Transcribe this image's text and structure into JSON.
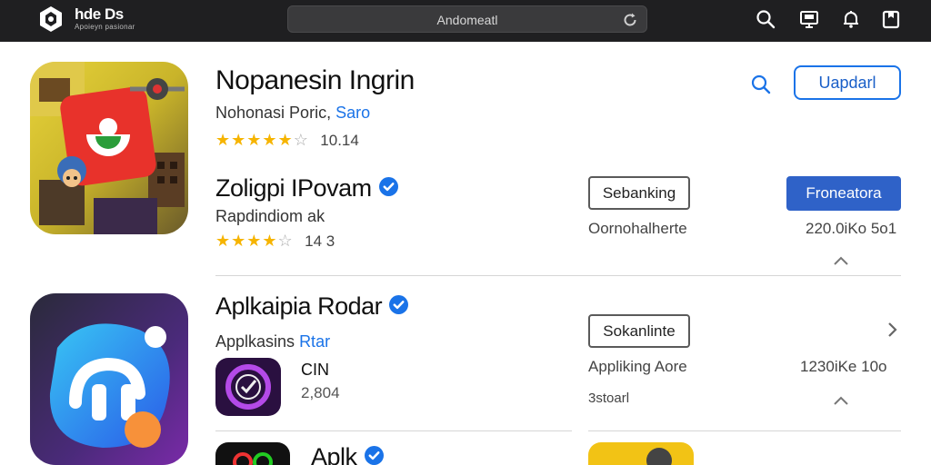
{
  "topbar": {
    "brand": "hde Ds",
    "brand_sub": "Apoieyn pasionar",
    "search_value": "Andomeatl",
    "icons": [
      "logo-icon",
      "refresh-icon",
      "search-icon",
      "cast-icon",
      "bell-icon",
      "bookmark-icon"
    ]
  },
  "featured": {
    "title": "Nopanesin Ingrin",
    "subtitle_plain": "Nohonasi Poric, ",
    "subtitle_link": "Saro",
    "rating": "10.14",
    "stars_filled": 4.5,
    "search_icon": "search-icon",
    "action_label": "Uapdarl"
  },
  "app1": {
    "title": "Zoligpi IPovam",
    "subtitle": "Rapdindiom ak",
    "rating": "14 3",
    "stars_filled": 4,
    "secondary_button": "Sebanking",
    "primary_button": "Froneatora",
    "meta_left": "Oornohalherte",
    "meta_right": "220.0iKo 5o1"
  },
  "app2": {
    "title": "Aplkaipia Rodar",
    "subtitle_plain": "Applkasins ",
    "subtitle_link": "Rtar",
    "secondary_button": "Sokanlinte",
    "meta_left": "Appliking Aore",
    "meta_right": "1230iKe 10o",
    "meta_sub": "3stoarl"
  },
  "mini_app": {
    "title": "CIN",
    "value": "2,804"
  },
  "app3": {
    "title": "Aplk"
  },
  "colors": {
    "topbar": "#1f1f21",
    "accent": "#1a73e8",
    "primary_button": "#2f62c8",
    "star": "#f6b400"
  }
}
